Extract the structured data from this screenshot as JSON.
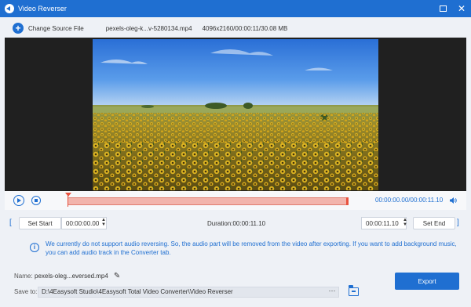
{
  "window": {
    "title": "Video Reverser",
    "accent": "#1f6fd1"
  },
  "toolbar": {
    "change_source_label": "Change Source File",
    "file_name": "pexels-oleg-k...v-5280134.mp4",
    "file_info": "4096x2160/00:00:11/30.08 MB"
  },
  "preview": {
    "image": "sunflower-field-aerial-frame"
  },
  "timeline": {
    "current_time": "00:00:00.00",
    "separator": "/",
    "total_time": "00:00:11.10",
    "track_color": "#f2b4ac",
    "handle_color": "#e8523e"
  },
  "trim": {
    "set_start_label": "Set Start",
    "start_time": "00:00:00.00",
    "duration_text": "Duration:00:00:11.10",
    "end_time": "00:00:11.10",
    "set_end_label": "Set End"
  },
  "notice": {
    "line1": "We currently do not support audio reversing. So, the audio part will be removed from the video after exporting. If you want to add background music,",
    "line2": "you can add audio track in the Converter tab."
  },
  "output": {
    "name_label": "Name:",
    "name_value": "pexels-oleg...eversed.mp4",
    "save_label": "Save to:",
    "save_path": "D:\\4Easysoft Studio\\4Easysoft Total Video Converter\\Video Reverser",
    "path_dots": "···",
    "export_label": "Export"
  }
}
